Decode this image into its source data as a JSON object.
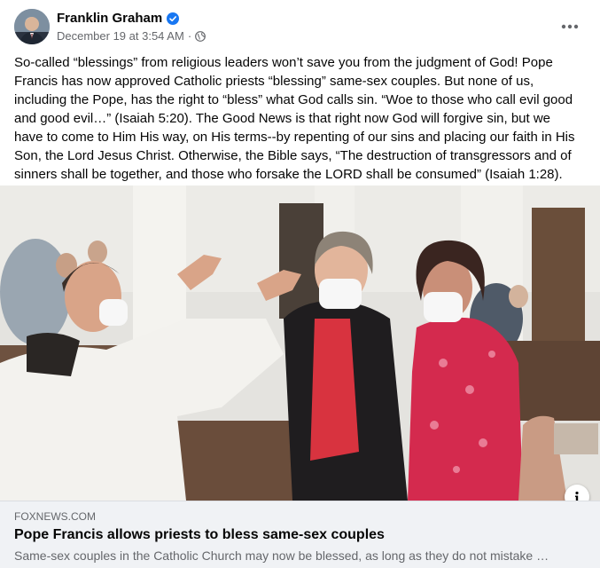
{
  "post": {
    "author": "Franklin Graham",
    "date": "December 19 at 3:54 AM",
    "separator": "·",
    "body": "So-called “blessings” from religious leaders won’t save you from the judgment of God! Pope Francis has now approved Catholic priests “blessing” same-sex couples. But none of us, including the Pope, has the right to “bless” what God calls sin. “Woe to those who call evil good and good evil…” (Isaiah 5:20). The Good News is that right now God will forgive sin, but we have to come to Him His way, on His terms--by repenting of our sins and placing our faith in His Son, the Lord Jesus Christ. Otherwise, the Bible says, “The destruction of transgressors and of sinners shall be together, and those who forsake the LORD shall be consumed” (Isaiah 1:28).",
    "icons": {
      "verified": "verified-badge-icon",
      "audience": "globe-icon",
      "more": "more-options-icon",
      "info": "info-icon"
    }
  },
  "link_preview": {
    "domain": "FOXNEWS.COM",
    "title": "Pope Francis allows priests to bless same-sex couples",
    "description": "Same-sex couples in the Catholic Church may now be blessed, as long as they do not mistake …"
  },
  "colors": {
    "verified": "#1877f2",
    "secondary_text": "#65676b",
    "link_box_bg": "#f0f2f5"
  }
}
